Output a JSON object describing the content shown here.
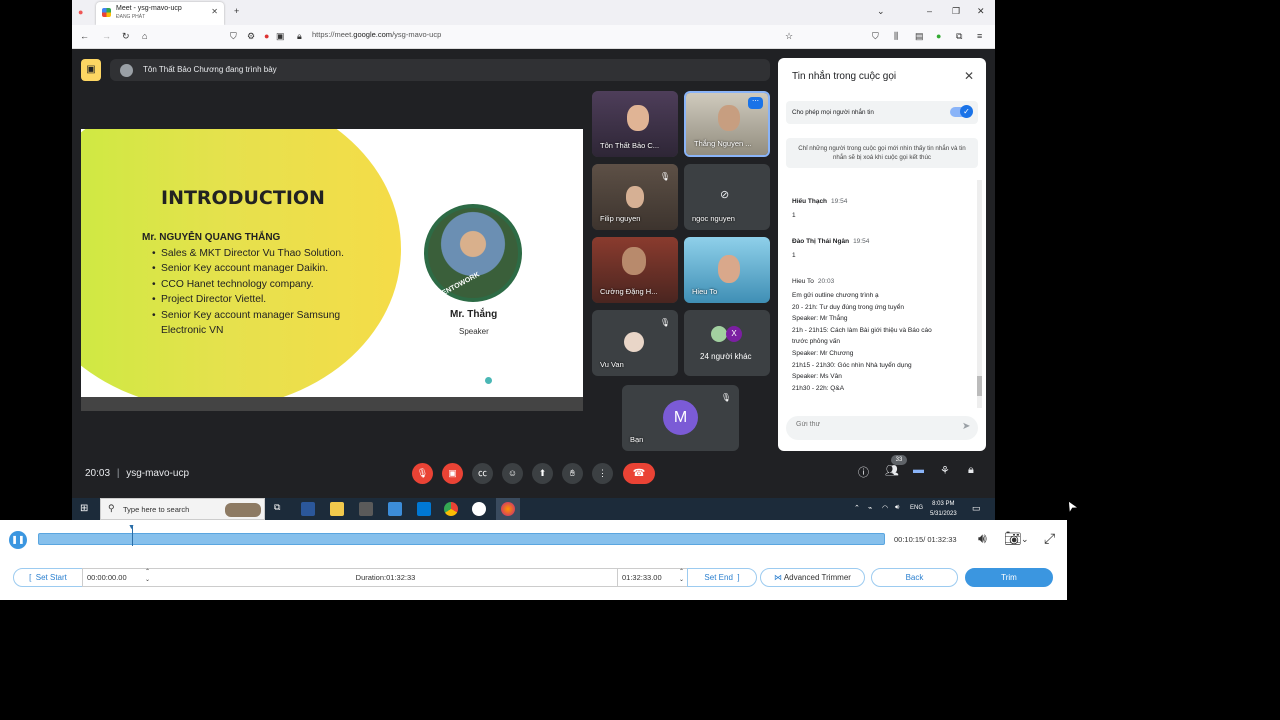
{
  "browser": {
    "tab_title": "Meet - ysg-mavo-ucp",
    "tab_subtitle": "ĐANG PHÁT",
    "url_prefix": "https://meet.",
    "url_domain": "google.com",
    "url_path": "/ysg-mavo-ucp"
  },
  "meet": {
    "presenting_text": "Tôn Thất Bảo Chương đang trình bày",
    "slide": {
      "title": "INTRODUCTION",
      "name": "Mr. NGUYỄN QUANG THẮNG",
      "items": [
        "Sales & MKT Director Vu Thao Solution.",
        "Senior Key account manager Daikin.",
        "CCO Hanet technology company.",
        "Project Director Viettel.",
        "Senior Key account manager Samsung Electronic VN"
      ],
      "photo_tag": "#OPENTOWORK",
      "speaker_name": "Mr. Thắng",
      "speaker_role": "Speaker"
    },
    "tiles": [
      {
        "name": "Tôn Thất Bảo C...",
        "color": "#5a4b63"
      },
      {
        "name": "Thắng Nguyen ...",
        "color": "#8a8476"
      },
      {
        "name": "Filip nguyen",
        "color": "#6e5e52"
      },
      {
        "name": "ngoc nguyen",
        "color": "#3c4043"
      },
      {
        "name": "Cường Đặng H...",
        "color": "#7a3a2e"
      },
      {
        "name": "Hieu To",
        "color": "#5aa7c8"
      },
      {
        "name": "Vu Van",
        "color": "#3c4043"
      },
      {
        "name": "24 người khác",
        "color": "#3c4043"
      },
      {
        "name": "Bạn",
        "color": "#3c4043"
      }
    ],
    "self_avatar_letter": "M",
    "others_avatar_letter": "X",
    "time": "20:03",
    "meeting_code": "ysg-mavo-ucp",
    "participant_count": "33"
  },
  "chat": {
    "title": "Tin nhắn trong cuộc gọi",
    "allow_label": "Cho phép mọi người nhắn tin",
    "info": "Chỉ những người trong cuộc gọi mới nhìn thấy tin nhắn và tin nhắn sẽ bị xoá khi cuộc gọi kết thúc",
    "messages": [
      {
        "sender": "Hiếu Thạch",
        "time": "19:54",
        "lines": [
          "1"
        ]
      },
      {
        "sender": "Đào Thị Thái Ngân",
        "time": "19:54",
        "lines": [
          "1"
        ]
      },
      {
        "sender": "Hieu To",
        "time": "20:03",
        "lines": [
          "Em gửi outline chương trình ạ",
          "20 - 21h: Tư duy đúng trong ứng tuyển",
          "Speaker: Mr Thắng",
          "21h - 21h15: Cách làm Bài giới thiệu và Báo cáo",
          "trước phỏng vấn",
          "Speaker: Mr Chương",
          "21h15 - 21h30: Góc nhìn Nhà tuyển dụng",
          "Speaker: Ms Vân",
          "21h30 - 22h: Q&A"
        ]
      }
    ],
    "compose_placeholder": "Gửi thư"
  },
  "taskbar": {
    "search_placeholder": "Type here to search",
    "lang": "ENG",
    "clock_time": "8:03 PM",
    "clock_date": "5/31/2023"
  },
  "player": {
    "timecode": "00:10:15/ 01:32:33",
    "progress_fraction": 0.111,
    "set_start": "Set Start",
    "start_time": "00:00:00.00",
    "duration": "Duration:01:32:33",
    "end_time": "01:32:33.00",
    "set_end": "Set End",
    "advanced_trimmer": "Advanced Trimmer",
    "back": "Back",
    "trim": "Trim"
  }
}
